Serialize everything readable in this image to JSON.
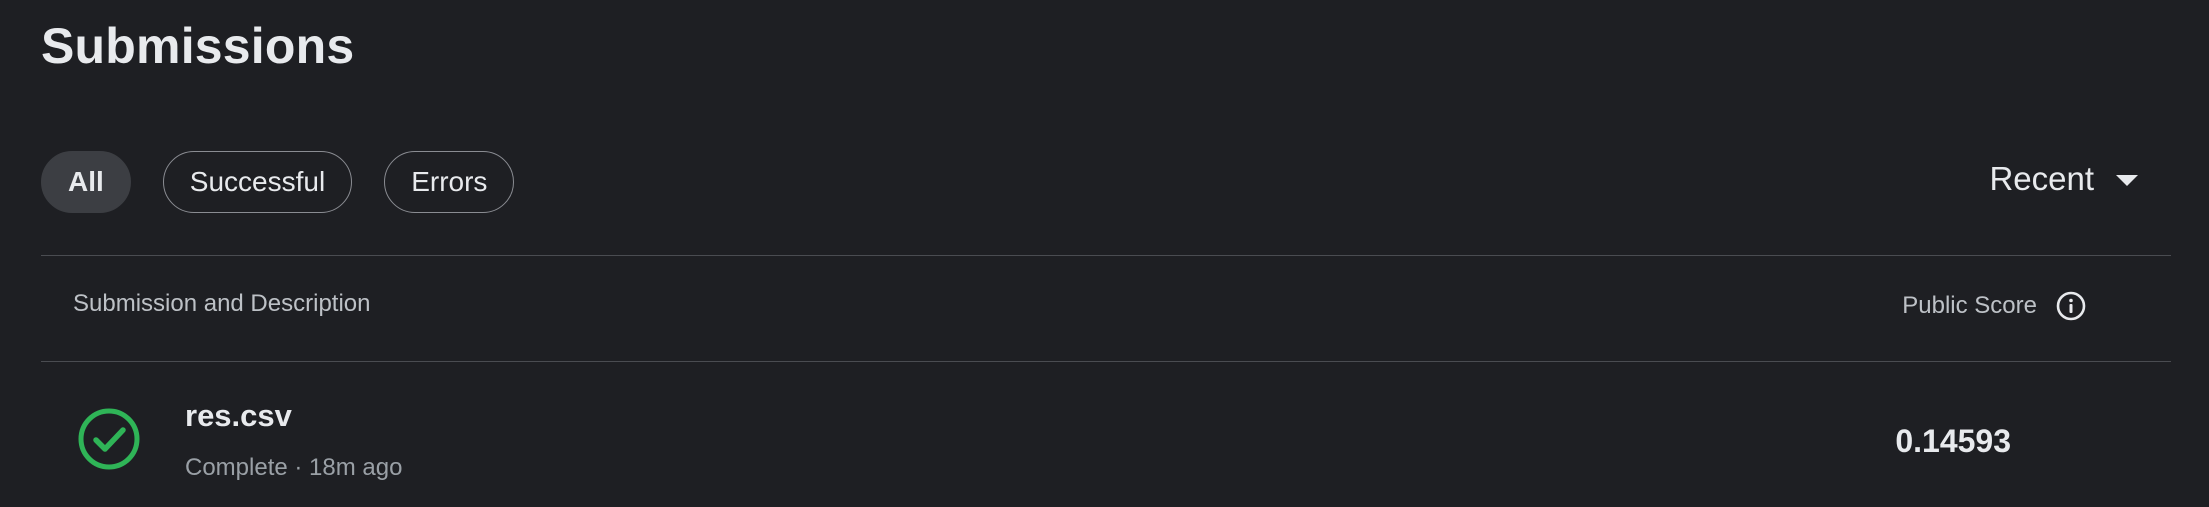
{
  "page": {
    "title": "Submissions"
  },
  "filters": {
    "all": "All",
    "successful": "Successful",
    "errors": "Errors"
  },
  "sort": {
    "label": "Recent",
    "icon": "caret-down-icon"
  },
  "table": {
    "col_submission": "Submission and Description",
    "col_score": "Public Score",
    "rows": [
      {
        "file": "res.csv",
        "status": "Complete",
        "separator": " · ",
        "time": "18m ago",
        "score": "0.14593",
        "status_color": "#2fb457"
      }
    ]
  }
}
